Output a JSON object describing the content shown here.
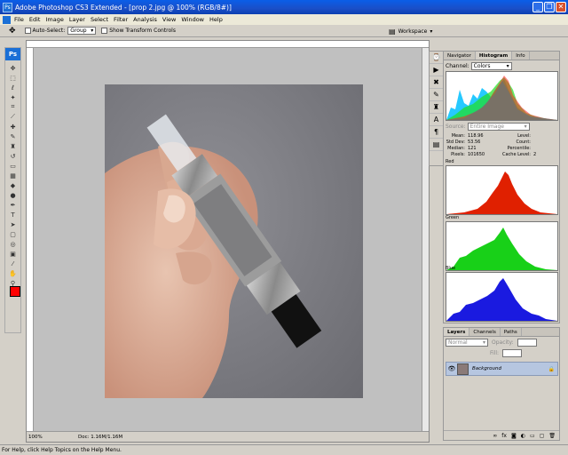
{
  "title_bar": {
    "title": "Adobe Photoshop CS3 Extended - [prop 2.jpg @ 100% (RGB/8#)]",
    "ps_badge": "Ps",
    "minimize": "_",
    "restore": "❐",
    "close": "✕"
  },
  "menu": [
    "File",
    "Edit",
    "Image",
    "Layer",
    "Select",
    "Filter",
    "Analysis",
    "View",
    "Window",
    "Help"
  ],
  "options": {
    "auto_select_label": "Auto-Select:",
    "auto_select_value": "Group",
    "show_transform_label": "Show Transform Controls",
    "workspace_label": "Workspace"
  },
  "toolbox": {
    "logo": "Ps"
  },
  "document": {
    "zoom": "100%",
    "doc_info": "Doc: 1.16M/1.16M"
  },
  "panels": {
    "top_tabs": [
      "Navigator",
      "Histogram",
      "Info"
    ],
    "channel_label": "Channel:",
    "channel_value": "Colors",
    "source_label": "Source:",
    "source_value": "Entire Image",
    "stats": [
      {
        "label": "Mean:",
        "value": "118.96",
        "label2": "Level:",
        "value2": ""
      },
      {
        "label": "Std Dev:",
        "value": "53.56",
        "label2": "Count:",
        "value2": ""
      },
      {
        "label": "Median:",
        "value": "121",
        "label2": "Percentile:",
        "value2": ""
      },
      {
        "label": "Pixels:",
        "value": "101650",
        "label2": "Cache Level:",
        "value2": "2"
      }
    ],
    "channels": [
      {
        "name": "Red",
        "color": "#e02000"
      },
      {
        "name": "Green",
        "color": "#18d018"
      },
      {
        "name": "Blue",
        "color": "#1a1ae0"
      }
    ],
    "layers_tabs": [
      "Layers",
      "Channels",
      "Paths"
    ],
    "blend_mode": "Normal",
    "opacity_label": "Opacity:",
    "fill_label": "Fill:",
    "layer_name": "Background"
  },
  "status": "For Help, click Help Topics on the Help Menu."
}
